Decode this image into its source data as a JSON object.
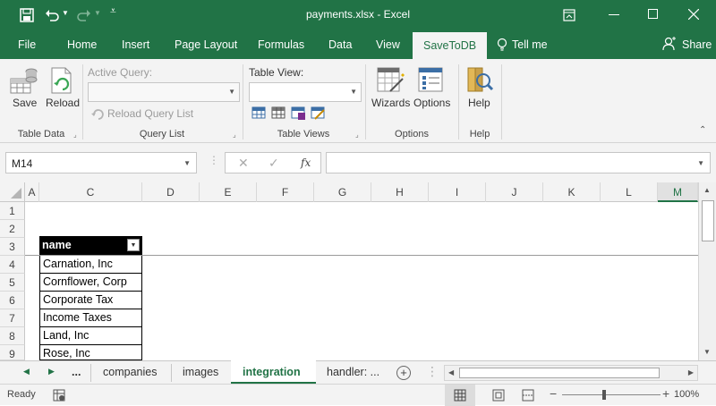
{
  "window": {
    "title": "payments.xlsx  -  Excel"
  },
  "ribbon_tabs": [
    {
      "label": "File"
    },
    {
      "label": "Home"
    },
    {
      "label": "Insert"
    },
    {
      "label": "Page Layout"
    },
    {
      "label": "Formulas"
    },
    {
      "label": "Data"
    },
    {
      "label": "View"
    },
    {
      "label": "SaveToDB"
    }
  ],
  "tell_me": "Tell me",
  "share": "Share",
  "groups": {
    "table_data": {
      "label": "Table Data",
      "save": "Save",
      "reload": "Reload"
    },
    "query_list": {
      "label": "Query List",
      "active_query": "Active Query:",
      "reload_query_list": "Reload Query List"
    },
    "table_views": {
      "label": "Table Views",
      "table_view": "Table View:"
    },
    "options": {
      "label": "Options",
      "wizards": "Wizards",
      "options": "Options"
    },
    "help": {
      "label": "Help",
      "help": "Help"
    }
  },
  "name_box": "M14",
  "fx": "fx",
  "columns": [
    "A",
    "C",
    "D",
    "E",
    "F",
    "G",
    "H",
    "I",
    "J",
    "K",
    "L",
    "M"
  ],
  "rows": [
    "1",
    "2",
    "3",
    "4",
    "5",
    "6",
    "7",
    "8",
    "9"
  ],
  "table": {
    "header": "name",
    "values": [
      "Carnation, Inc",
      "Cornflower, Corp",
      "Corporate Tax",
      "Income Taxes",
      "Land, Inc",
      "Rose, Inc"
    ]
  },
  "sheet_tabs": [
    "...",
    "companies",
    "images",
    "integration",
    "handler: ...",
    "..."
  ],
  "status": {
    "ready": "Ready",
    "zoom": "100%"
  },
  "colors": {
    "accent": "#217346"
  }
}
